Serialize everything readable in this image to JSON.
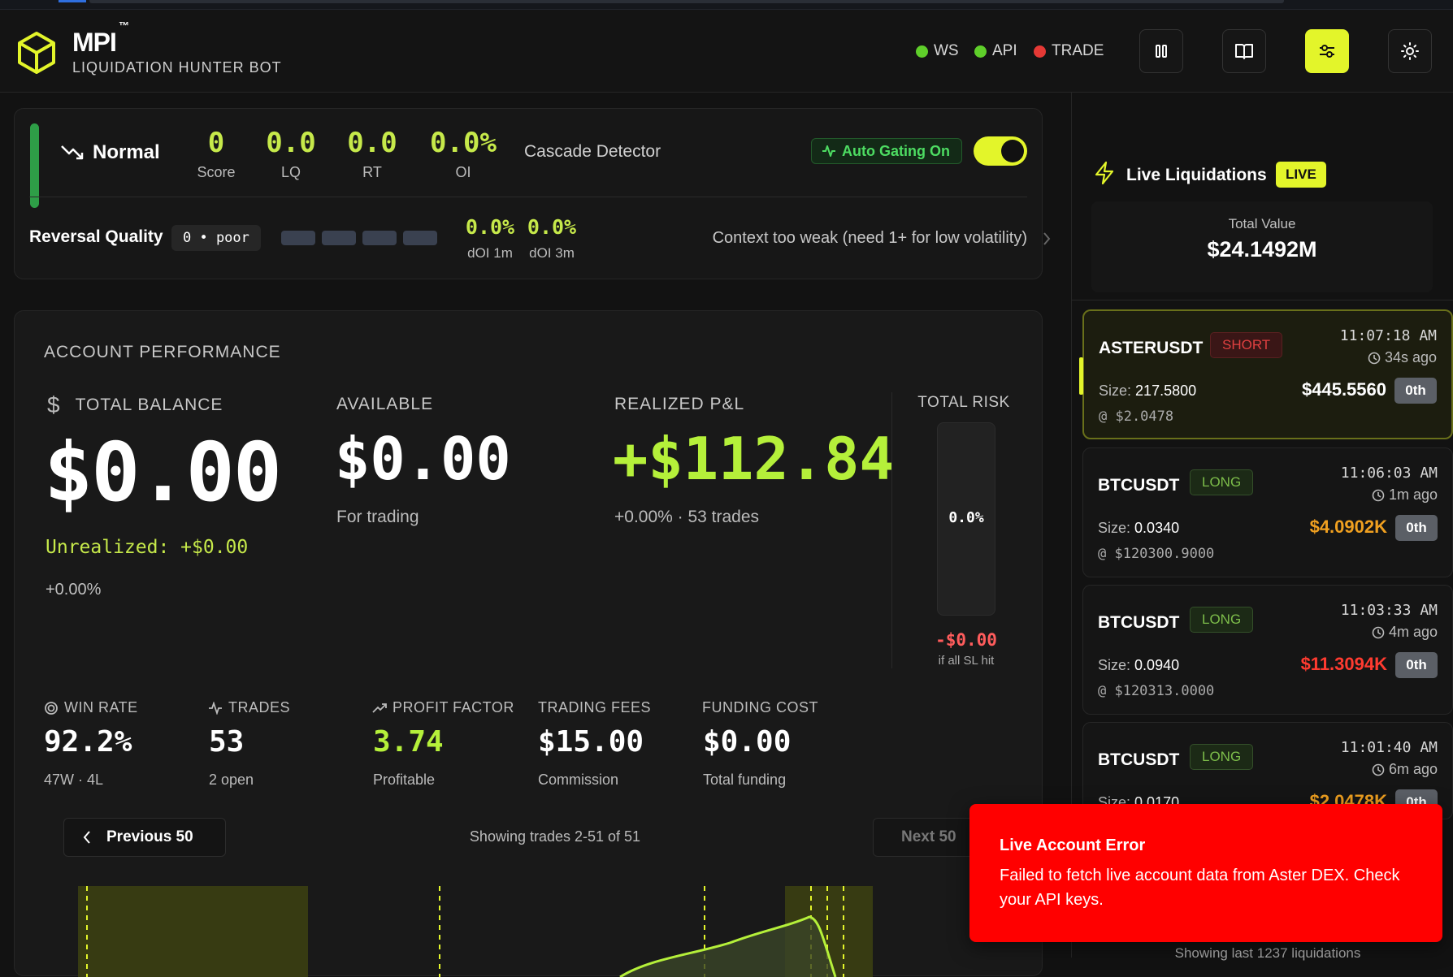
{
  "header": {
    "brand": "MPI",
    "trademark": "™",
    "subtitle": "LIQUIDATION HUNTER BOT",
    "status": [
      {
        "label": "WS",
        "color": "#5fcf2a"
      },
      {
        "label": "API",
        "color": "#5fcf2a"
      },
      {
        "label": "TRADE",
        "color": "#e53935"
      }
    ],
    "buttons": [
      "columns-icon",
      "book-icon",
      "sliders-icon",
      "sun-icon"
    ]
  },
  "cascade": {
    "state": "Normal",
    "metrics": [
      {
        "value": "0",
        "label": "Score"
      },
      {
        "value": "0.0",
        "label": "LQ"
      },
      {
        "value": "0.0",
        "label": "RT"
      },
      {
        "value": "0.0%",
        "label": "OI"
      }
    ],
    "title": "Cascade Detector",
    "gating": "Auto Gating On",
    "toggle_on": true
  },
  "reversal": {
    "label": "Reversal Quality",
    "badge": "0 • poor",
    "doi1_value": "0.0%",
    "doi1_label": "dOI 1m",
    "doi3_value": "0.0%",
    "doi3_label": "dOI 3m",
    "message": "Context too weak (need 1+ for low volatility)"
  },
  "account": {
    "title": "ACCOUNT PERFORMANCE",
    "total_balance_label": "TOTAL BALANCE",
    "total_balance": "$0.00",
    "unrealized": "Unrealized: +$0.00",
    "unrealized_pct": "+0.00%",
    "available_label": "AVAILABLE",
    "available": "$0.00",
    "available_sub": "For trading",
    "realized_label": "REALIZED P&L",
    "realized": "+$112.84",
    "realized_sub": "+0.00% · 53 trades",
    "risk_label": "TOTAL RISK",
    "risk_pct": "0.0%",
    "risk_value": "-$0.00",
    "risk_sub": "if all SL hit",
    "stats": [
      {
        "label": "WIN RATE",
        "value": "92.2%",
        "sub": "47W · 4L",
        "icon": "target-icon"
      },
      {
        "label": "TRADES",
        "value": "53",
        "sub": "2 open",
        "icon": "activity-icon"
      },
      {
        "label": "PROFIT FACTOR",
        "value": "3.74",
        "sub": "Profitable",
        "icon": "trending-up-icon"
      },
      {
        "label": "TRADING FEES",
        "value": "$15.00",
        "sub": "Commission"
      },
      {
        "label": "FUNDING COST",
        "value": "$0.00",
        "sub": "Total funding"
      }
    ],
    "prev": "Previous 50",
    "showing": "Showing trades 2-51 of 51",
    "next": "Next 50"
  },
  "live": {
    "title": "Live Liquidations",
    "badge": "LIVE",
    "total_label": "Total Value",
    "total_value": "$24.1492M",
    "items": [
      {
        "symbol": "ASTERUSDT",
        "side": "SHORT",
        "time": "11:07:18 AM",
        "ago": "34s ago",
        "size_label": "Size:",
        "size": "217.5800",
        "price": "@ $2.0478",
        "value": "$445.5560",
        "value_color": "#ffffff",
        "rank": "0th"
      },
      {
        "symbol": "BTCUSDT",
        "side": "LONG",
        "time": "11:06:03 AM",
        "ago": "1m ago",
        "size_label": "Size:",
        "size": "0.0340",
        "price": "@ $120300.9000",
        "value": "$4.0902K",
        "value_color": "#f0a020",
        "rank": "0th"
      },
      {
        "symbol": "BTCUSDT",
        "side": "LONG",
        "time": "11:03:33 AM",
        "ago": "4m ago",
        "size_label": "Size:",
        "size": "0.0940",
        "price": "@ $120313.0000",
        "value": "$11.3094K",
        "value_color": "#ff3b30",
        "rank": "0th"
      },
      {
        "symbol": "BTCUSDT",
        "side": "LONG",
        "time": "11:01:40 AM",
        "ago": "6m ago",
        "size_label": "Size:",
        "size": "0.0170",
        "price": "",
        "value": "$2.0478K",
        "value_color": "#f0a020",
        "rank": "0th"
      }
    ],
    "footer": "Showing last 1237 liquidations"
  },
  "toast": {
    "title": "Live Account Error",
    "message": "Failed to fetch live account data from Aster DEX. Check your API keys."
  }
}
